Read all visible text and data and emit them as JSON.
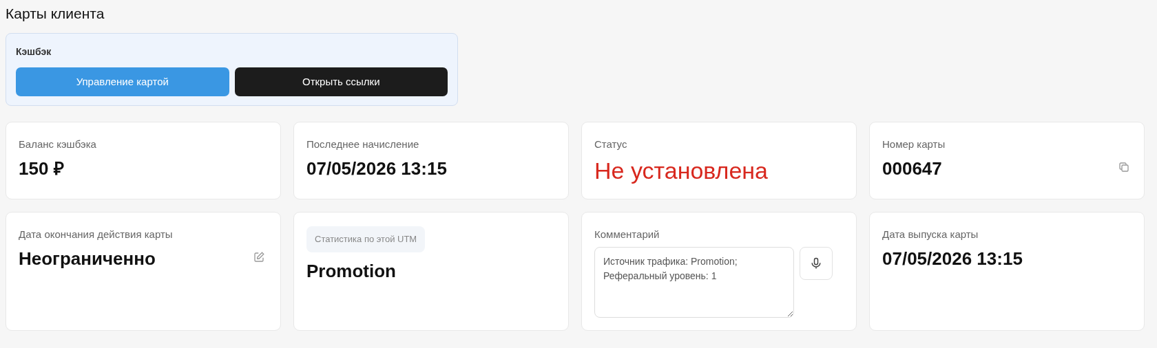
{
  "page_title": "Карты клиента",
  "cashback_panel": {
    "title": "Кэшбэк",
    "buttons": [
      {
        "label": "Управление картой",
        "kind": "primary"
      },
      {
        "label": "Открыть ссылки",
        "kind": "dark"
      }
    ]
  },
  "cards": [
    {
      "kind": "value",
      "label": "Баланс кэшбэка",
      "value": "150 ₽"
    },
    {
      "kind": "value",
      "label": "Последнее начисление",
      "value": "07/05/2026 13:15"
    },
    {
      "kind": "status",
      "label": "Статус",
      "value": "Не установлена"
    },
    {
      "kind": "copy",
      "label": "Номер карты",
      "value": "000647"
    },
    {
      "kind": "edit",
      "label": "Дата окончания действия карты",
      "value": "Неограниченно"
    },
    {
      "kind": "utm",
      "badge": "Статистика по этой UTM",
      "value": "Promotion"
    },
    {
      "kind": "comment",
      "label": "Комментарий",
      "value": "Источник трафика: Promotion;\nРеферальный уровень: 1"
    },
    {
      "kind": "value",
      "label": "Дата выпуска карты",
      "value": "07/05/2026 13:15"
    }
  ]
}
